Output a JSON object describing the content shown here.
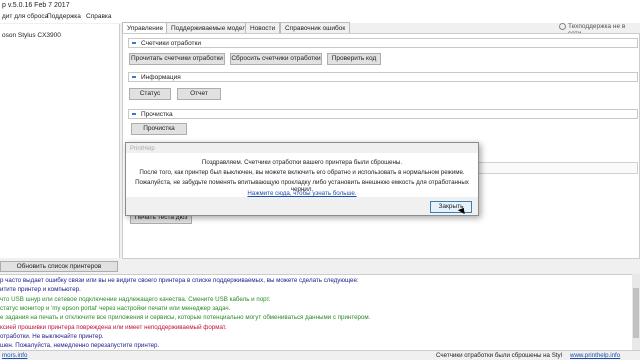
{
  "window": {
    "title": "p v.5.0.16 Feb  7 2017"
  },
  "menu": [
    "дит для сброса",
    "Поддержка",
    "Справка"
  ],
  "printers": {
    "selected": "oson Stylus CX3900",
    "refresh_label": "Обновить список принтеров"
  },
  "tabs": [
    "Управление",
    "Поддерживаемые модели",
    "Новости",
    "Справочник ошибок"
  ],
  "help_label": "Техподдержка не в сети",
  "sections": {
    "counters": {
      "title": "Счетчики отработки",
      "buttons": [
        "Прочитать счетчики отработки",
        "Сбросить счетчики отработки",
        "Проверить код"
      ]
    },
    "info": {
      "title": "Информация",
      "buttons": [
        "Статус",
        "Отчет"
      ]
    },
    "misc": {
      "title": "Прочистка",
      "buttons": [
        "Прочистка"
      ]
    },
    "test_button": "Печать теста дюз"
  },
  "dialog": {
    "title": "PrintHelp",
    "lines": [
      "Поздравляем. Счетчики отработки вашего принтера были сброшены.",
      "После того, как принтер был выключен, вы можете включить его обратно и использовать в нормальном режиме.",
      "Пожалуйста, не забудьте поменять впитывающую прокладку либо установить внешнюю емкость для отработанных чернил."
    ],
    "link": "Нажмите сюда, чтобы узнать больше.",
    "close": "Закрыть"
  },
  "log": [
    {
      "text": "р часто выдает ошибку связи или вы не видите своего принтера в списке поддерживаемых, вы можете сделать следующее:",
      "color": "#1a1a8c"
    },
    {
      "text": "итите принтер и компьютер.",
      "color": "#1a1a8c"
    },
    {
      "text": "что USB шнур или сетевое подключение надлежащего качества. Смените USB кабель и порт.",
      "color": "#2a8a2a"
    },
    {
      "text": "статус монитор  и  'my epson portal'  через настройки печати или менеджер задач.",
      "color": "#2a8a2a"
    },
    {
      "text": "е задания на печать и отключите все приложения и сервисы, которые потенциально могут обмениваться данными с принтером.",
      "color": "#2a8a2a"
    },
    {
      "text": "ксией прошивки принтера повреждена или имеет неподдерживаемый формат.",
      "color": "#c0103a"
    },
    {
      "text": "отработки. Не выключайте принтер.",
      "color": "#1a1a8c"
    },
    {
      "text": "шен. Пожалуйста, немедленно перезапустите принтер.",
      "color": "#1a1a8c"
    }
  ],
  "status": {
    "left": "mors.info",
    "message": "Счетчики отработки были сброшены на Styl",
    "link": "www.printhelp.info"
  },
  "colors": {
    "accent": "#3c7ac8",
    "link": "#1b4fae"
  }
}
